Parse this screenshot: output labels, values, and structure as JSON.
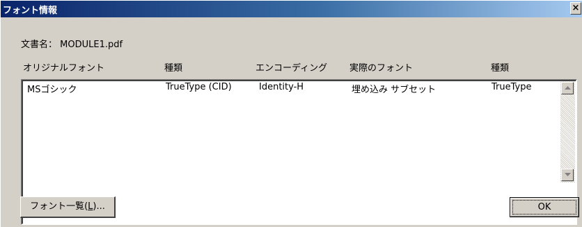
{
  "window": {
    "title": "フォント情報",
    "close_glyph": "×"
  },
  "document": {
    "label": "文書名：",
    "filename": "MODULE1.pdf"
  },
  "columns": [
    "オリジナルフォント",
    "種類",
    "エンコーディング",
    "実際のフォント",
    "種類"
  ],
  "rows": [
    {
      "original_font": "MSゴシック",
      "type": "TrueType (CID)",
      "encoding": "Identity-H",
      "actual_font": "埋め込み サブセット",
      "actual_type": "TrueType"
    }
  ],
  "buttons": {
    "font_list_prefix": "フォント一覧(",
    "font_list_mnemonic": "L",
    "font_list_suffix": ")...",
    "ok": "OK"
  },
  "colors": {
    "face": "#d4d0c8",
    "title_start": "#0a246a",
    "title_end": "#a6caf0"
  }
}
